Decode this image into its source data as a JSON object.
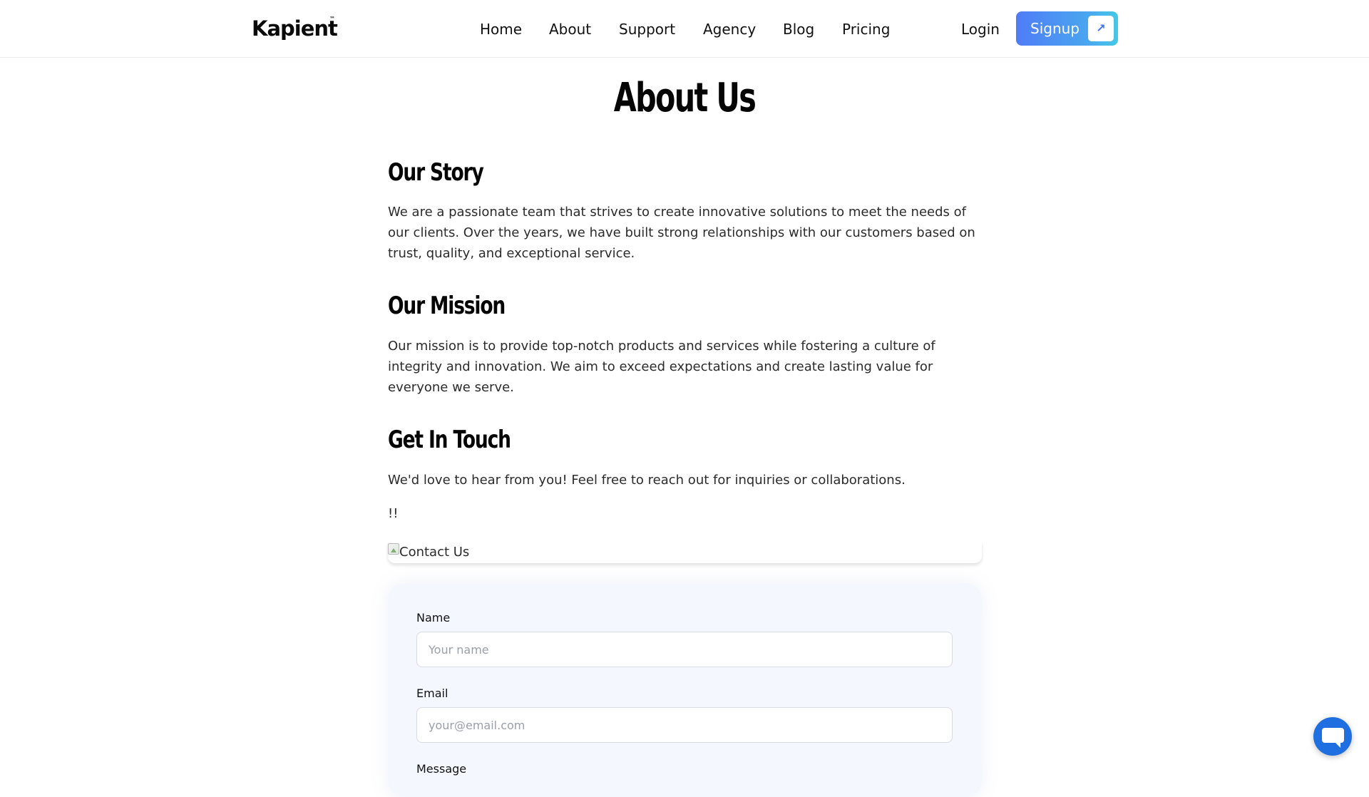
{
  "header": {
    "logo_text": "Kapient",
    "logo_mark": "™",
    "nav": [
      "Home",
      "About",
      "Support",
      "Agency",
      "Blog",
      "Pricing"
    ],
    "login_label": "Login",
    "signup_label": "Signup",
    "signup_icon": "arrow-up-right-icon",
    "signup_arrow": "↗",
    "accent_gradient": [
      "#4f7cf7",
      "#45c8e6"
    ]
  },
  "main": {
    "title": "About Us",
    "sections": [
      {
        "heading": "Our Story",
        "text": "We are a passionate team that strives to create innovative solutions to meet the needs of our clients. Over the years, we have built strong relationships with our customers based on trust, quality, and exceptional service."
      },
      {
        "heading": "Our Mission",
        "text": "Our mission is to provide top-notch products and services while fostering a culture of integrity and innovation. We aim to exceed expectations and create lasting value for everyone we serve."
      },
      {
        "heading": "Get In Touch",
        "text": "We'd love to hear from you! Feel free to reach out for inquiries or collaborations."
      }
    ],
    "exclaim": "!!",
    "contact_image_alt": "Contact Us"
  },
  "form": {
    "name_label": "Name",
    "name_placeholder": "Your name",
    "email_label": "Email",
    "email_placeholder": "your@email.com",
    "message_label": "Message"
  },
  "chat": {
    "icon": "chat-bubble-icon",
    "color": "#1f6fe0"
  }
}
